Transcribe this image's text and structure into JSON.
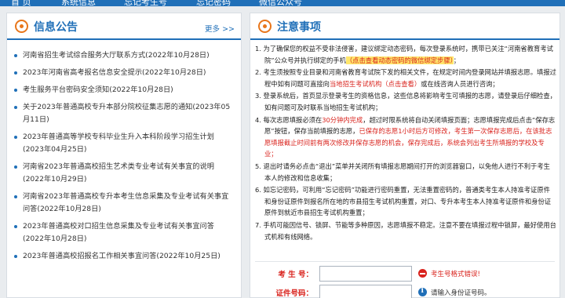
{
  "nav": {
    "items": [
      "首 页",
      "系统信息",
      "忘记考生号",
      "忘记密码",
      "微信公众号"
    ]
  },
  "announcements": {
    "title": "信息公告",
    "more": "更多 >>",
    "items": [
      "河南省招生考试综合服务大厅联系方式(2022年10月28日)",
      "2023年河南省高考报名信息安全提示(2022年10月28日)",
      "考生服务平台密码安全须知(2022年10月28日)",
      "关于2023年普通高校专升本部分院校征集志愿的通知(2023年05月11日)",
      "2023年普通高等学校专科毕业生升入本科阶段学习招生计划(2023年04月25日)",
      "河南省2023年普通高校招生艺术类专业考试有关事宜的说明(2022年10月29日)",
      "河南省2023年普通高校专升本考生信息采集及专业考试有关事宜问答(2022年10月28日)",
      "2023年普通高校对口招生信息采集及专业考试有关事宜问答(2022年10月28日)",
      "2023年普通高校招报名工作相关事宜问答(2022年10月25日)"
    ]
  },
  "notes": {
    "title": "注意事项",
    "items": [
      {
        "segments": [
          {
            "t": "1. 为了确保您的权益不受非法侵害，建议绑定动态密码，每次登录系统时，携带已关注“河南省教育考试院”公众号并执行绑定的手机",
            "s": ""
          },
          {
            "t": "（点击查看动态密码的微信绑定步骤）",
            "s": "hl-bg"
          },
          {
            "t": "；",
            "s": ""
          }
        ]
      },
      {
        "segments": [
          {
            "t": "2. 考生须按照专业目录和河南省教育考试院下发的相关文件，在规定时间内登录网站并填报志愿。填报过程中如有问题可直接向",
            "s": ""
          },
          {
            "t": "当地招生考试机构（点击查看）",
            "s": "hl"
          },
          {
            "t": "或在线咨询人员进行咨询；",
            "s": ""
          }
        ]
      },
      {
        "segments": [
          {
            "t": "3. 登录系统后，首页显示登录考生的资格信息，这些信息将影响考生可填报的志愿，请登录后仔细检查，如有问题可及时联系当地招生考试机构；",
            "s": ""
          }
        ]
      },
      {
        "segments": [
          {
            "t": "4. 每次志愿填报必须在",
            "s": ""
          },
          {
            "t": "30分钟内完成",
            "s": "hl"
          },
          {
            "t": "，超过时限系统将自动关闭填报页面；志愿填报完成后点击“保存志愿”按钮，保存当前填报的志愿，",
            "s": ""
          },
          {
            "t": "已保存的志愿1小时后方可修改，考生第一次保存志愿后，在该批志愿填报截止时间前有两次修改并保存志愿的机会，保存完成后，系统会列出考生所填报的学校及专业；",
            "s": "hl"
          }
        ]
      },
      {
        "segments": [
          {
            "t": "5. 退出时请务必点击“退出”菜单并关闭所有填报志愿期间打开的浏览器窗口，以免他人进行不利于考生本人的修改和信息收集；",
            "s": ""
          }
        ]
      },
      {
        "segments": [
          {
            "t": "6. 如忘记密码，可利用“忘记密码”功能进行密码重置，无法重置密码的，普通类考生本人持准考证原件和身份证原件到报名所在地的市县招生考试机构重置，对口、专升本考生本人持准考证原件和身份证原件到就近市县招生考试机构重置；",
            "s": ""
          }
        ]
      },
      {
        "segments": [
          {
            "t": "7. 手机可能因信号、锁屏、节能等多种原因，志愿填报不稳定。注意不要在填报过程中锁屏，最好使用台式机和有线网络。",
            "s": ""
          }
        ]
      }
    ]
  },
  "form": {
    "candidate_label": "考 生 号：",
    "candidate_value": "",
    "candidate_hint": "考生号格式错误!",
    "id_label": "证件号码：",
    "id_value": "",
    "id_hint": "请输入身份证号码。"
  },
  "colors": {
    "primary": "#1f6fb8",
    "accent": "#e8761b",
    "alert": "#d9231d",
    "highlight": "#ffe66b"
  },
  "icons": {
    "announcement": "bullseye-icon",
    "notes": "bullseye-icon",
    "error": "minus-circle-icon",
    "info": "info-circle-icon"
  }
}
